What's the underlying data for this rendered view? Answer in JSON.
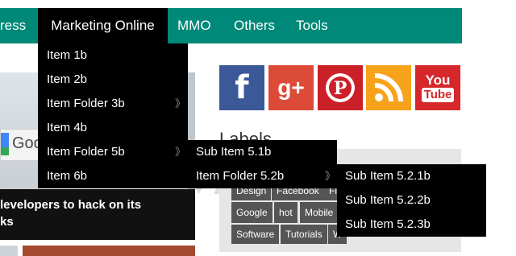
{
  "nav": {
    "items": [
      {
        "label": "ress",
        "active": false
      },
      {
        "label": "Marketing Online",
        "active": true
      },
      {
        "label": "MMO",
        "active": false
      },
      {
        "label": "Others",
        "active": false
      },
      {
        "label": "Tools",
        "active": false
      }
    ],
    "bar_color": "#008878",
    "active_color": "#000000"
  },
  "dropdown": {
    "items": [
      {
        "label": "Item 1b",
        "has_submenu": false
      },
      {
        "label": "Item 2b",
        "has_submenu": false
      },
      {
        "label": "Item Folder 3b",
        "has_submenu": true
      },
      {
        "label": "Item 4b",
        "has_submenu": false
      },
      {
        "label": "Item Folder 5b",
        "has_submenu": true
      },
      {
        "label": "Item 6b",
        "has_submenu": false
      }
    ],
    "submenu_arrow": "》"
  },
  "submenu_5b": {
    "items": [
      {
        "label": "Sub Item 5.1b",
        "has_submenu": false
      },
      {
        "label": "Item Folder 5.2b",
        "has_submenu": true
      }
    ]
  },
  "submenu_52b": {
    "items": [
      {
        "label": "Sub Item 5.2.1b"
      },
      {
        "label": "Sub Item 5.2.2b"
      },
      {
        "label": "Sub Item 5.2.3b"
      }
    ]
  },
  "left_content": {
    "google_text": "Goo",
    "blog_title_line1": "levelopers to hack on its",
    "blog_title_line2": "ks"
  },
  "social": {
    "facebook": "f",
    "google_plus": "g+",
    "pinterest": "P",
    "rss_icon": "rss-icon",
    "youtube_top": "You",
    "youtube_bottom": "Tube",
    "colors": {
      "facebook": "#3b5998",
      "google_plus": "#dc4a38",
      "pinterest": "#cb2027",
      "rss": "#f7a21b",
      "youtube": "#d6282b"
    }
  },
  "labels": {
    "heading": "Labels",
    "tags_row1": [
      "Design",
      "Facebook",
      "Fi"
    ],
    "tags_row2": [
      "Google",
      "hot",
      "Mobile"
    ],
    "tags_row3": [
      "Software",
      "Tutorials",
      "W"
    ]
  }
}
